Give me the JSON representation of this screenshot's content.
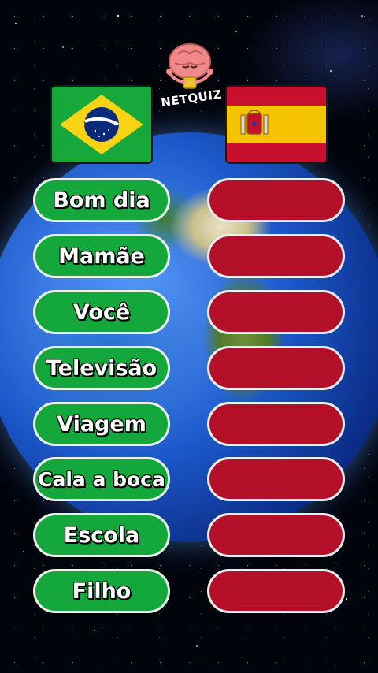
{
  "brand": {
    "name": "NETQUIZ",
    "colors": {
      "green": "#14a83c",
      "red": "#b5102a"
    }
  },
  "flags": {
    "left": {
      "icon": "brazil-flag-icon"
    },
    "right": {
      "icon": "spain-flag-icon"
    }
  },
  "words": [
    {
      "pt": "Bom dia"
    },
    {
      "pt": "Mamãe"
    },
    {
      "pt": "Você"
    },
    {
      "pt": "Televisão"
    },
    {
      "pt": "Viagem"
    },
    {
      "pt": "Cala a boca"
    },
    {
      "pt": "Escola"
    },
    {
      "pt": "Filho"
    }
  ]
}
